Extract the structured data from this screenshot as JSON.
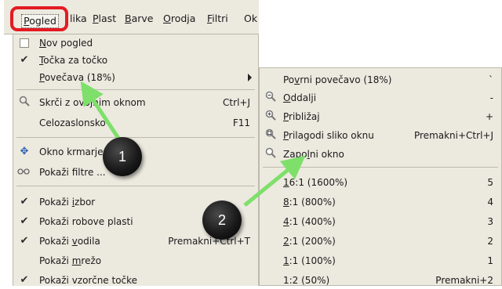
{
  "menubar": {
    "items": [
      {
        "label": "Pogled",
        "u": "P"
      },
      {
        "label": "Slika"
      },
      {
        "label": "Plast",
        "u": "P"
      },
      {
        "label": "Barve",
        "u": "B"
      },
      {
        "label": "Orodja",
        "u": "O"
      },
      {
        "label": "Filtri",
        "u": "F"
      },
      {
        "label": "Ok"
      }
    ]
  },
  "menu1": {
    "items": [
      {
        "label": "Nov pogled",
        "check": "box"
      },
      {
        "label": "Točka za točko",
        "check": "✔"
      },
      {
        "label": "Povečava (18%)",
        "submenu": true
      },
      {
        "label": "Skrči z ovojnim oknom",
        "icon": "magnifier-icon",
        "shortcut": "Ctrl+J"
      },
      {
        "label": "Celozaslonsko",
        "shortcut": "F11"
      },
      {
        "label": "Okno krmarjenja",
        "icon": "navigate-icon"
      },
      {
        "label": "Pokaži filtre ...",
        "icon": "glasses-icon"
      },
      {
        "label": "Pokaži izbor",
        "check": "✔"
      },
      {
        "label": "Pokaži robove plasti",
        "check": "✔"
      },
      {
        "label": "Pokaži vodila",
        "check": "✔",
        "shortcut": "Premakni+Ctrl+T"
      },
      {
        "label": "Pokaži mrežo"
      },
      {
        "label": "Pokaži vzorčne točke",
        "check": "✔"
      }
    ]
  },
  "menu2": {
    "items": [
      {
        "label": "Povrni povečavo (18%)",
        "shortcut": "`"
      },
      {
        "label": "Oddalji",
        "icon": "zoom-out-icon",
        "shortcut": "-"
      },
      {
        "label": "Približaj",
        "icon": "zoom-in-icon",
        "shortcut": "+"
      },
      {
        "label": "Prilagodi sliko oknu",
        "icon": "zoom-fit-icon",
        "shortcut": "Premakni+Ctrl+J"
      },
      {
        "label": "Zapolni okno",
        "icon": "zoom-fill-icon"
      },
      {
        "label": "16:1 (1600%)",
        "shortcut": "5"
      },
      {
        "label": "8:1 (800%)",
        "shortcut": "4"
      },
      {
        "label": "4:1 (400%)",
        "shortcut": "3"
      },
      {
        "label": "2:1 (200%)",
        "shortcut": "2"
      },
      {
        "label": "1:1 (100%)",
        "shortcut": "1"
      },
      {
        "label": "1:2 (50%)",
        "shortcut": "Premakni+2"
      }
    ]
  },
  "callouts": {
    "one": "1",
    "two": "2"
  },
  "colors": {
    "highlight": "#e31b23",
    "arrow": "#7ee06a",
    "menu_bg": "#ece9df"
  }
}
